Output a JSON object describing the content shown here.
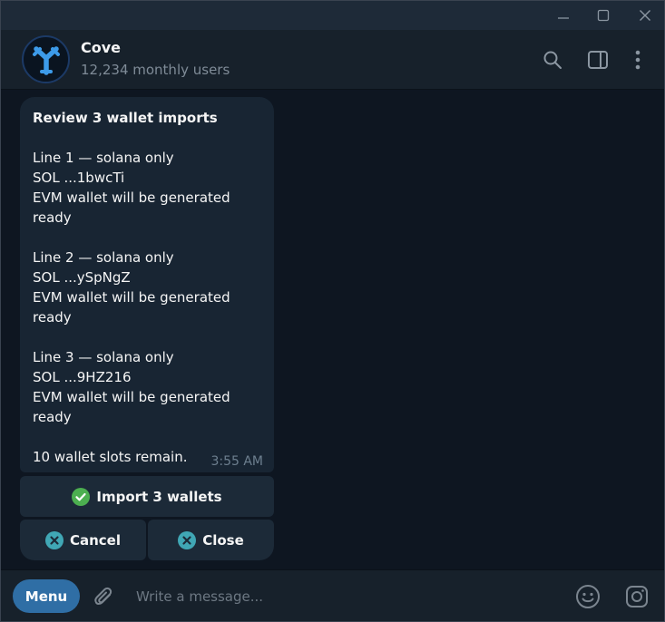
{
  "window": {
    "controls": [
      "minimize-icon",
      "maximize-icon",
      "close-icon"
    ]
  },
  "header": {
    "name": "Cove",
    "subtitle": "12,234 monthly users",
    "icons": [
      "search-icon",
      "sidebar-toggle-icon",
      "more-vert-icon"
    ]
  },
  "message": {
    "title": "Review 3 wallet imports",
    "entries": [
      {
        "heading": "Line 1 — solana only",
        "address": "SOL ...1bwcTi",
        "note": "EVM wallet will be generated",
        "status": "ready"
      },
      {
        "heading": "Line 2 — solana only",
        "address": "SOL ...ySpNgZ",
        "note": "EVM wallet will be generated",
        "status": "ready"
      },
      {
        "heading": "Line 3 — solana only",
        "address": "SOL ...9HZ216",
        "note": "EVM wallet will be generated",
        "status": "ready"
      }
    ],
    "footer": "10 wallet slots remain.",
    "time": "3:55 AM"
  },
  "keyboard": {
    "import_label": "Import 3 wallets",
    "cancel_label": "Cancel",
    "close_label": "Close"
  },
  "composer": {
    "menu_label": "Menu",
    "placeholder": "Write a message...",
    "icons": [
      "attach-icon",
      "emoji-icon",
      "instagram-icon"
    ]
  },
  "colors": {
    "background": "#0e1621",
    "header": "#17212b",
    "bubble": "#182533",
    "accent": "#2f6ea5",
    "check_green": "#4caf50",
    "cancel_teal": "#40a7b5"
  }
}
